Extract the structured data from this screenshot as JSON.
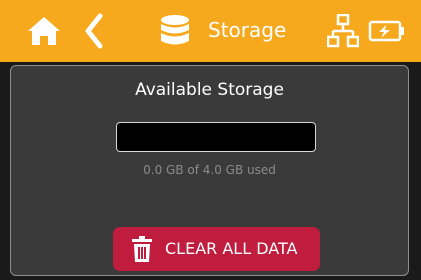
{
  "header": {
    "title": "Storage",
    "icons": {
      "home": "home-icon",
      "back": "chevron-left-icon",
      "section": "database-icon",
      "network": "network-icon",
      "battery": "battery-charging-icon"
    },
    "background_color": "#f6a91c"
  },
  "storage": {
    "heading": "Available Storage",
    "usage_text": "0.0 GB of 4.0 GB used",
    "used_gb": 0.0,
    "total_gb": 4.0,
    "used_fraction": 0.0
  },
  "actions": {
    "clear_all_label": "CLEAR ALL DATA",
    "clear_all_icon": "trash-icon",
    "clear_all_color": "#c01c3e"
  },
  "theme": {
    "panel_color": "#3a3a3a",
    "background_color": "#1a1a1a"
  }
}
